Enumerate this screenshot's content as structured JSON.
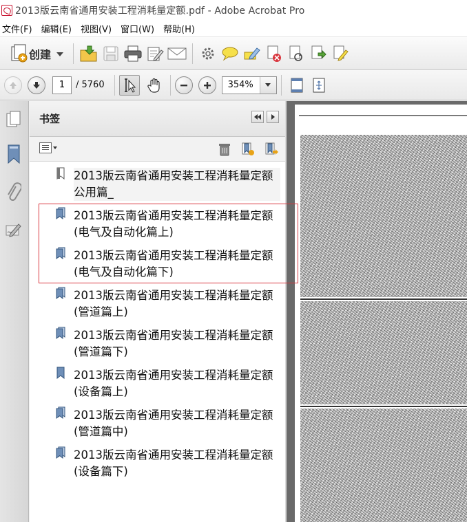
{
  "window": {
    "title": "2013版云南省通用安装工程消耗量定额.pdf - Adobe Acrobat Pro"
  },
  "menu": {
    "items": [
      "文件(F)",
      "编辑(E)",
      "视图(V)",
      "窗口(W)",
      "帮助(H)"
    ]
  },
  "toolbar": {
    "create_label": "创建"
  },
  "navigation": {
    "current_page": "1",
    "total_pages": "/ 5760",
    "zoom": "354%"
  },
  "bookmarks": {
    "panel_title": "书签",
    "items": [
      {
        "label": "2013版云南省通用安装工程消耗量定额公用篇_"
      },
      {
        "label": "2013版云南省通用安装工程消耗量定额(电气及自动化篇上)"
      },
      {
        "label": "2013版云南省通用安装工程消耗量定额(电气及自动化篇下)"
      },
      {
        "label": "2013版云南省通用安装工程消耗量定额(管道篇上)"
      },
      {
        "label": "2013版云南省通用安装工程消耗量定额(管道篇下)"
      },
      {
        "label": "2013版云南省通用安装工程消耗量定额(设备篇上)"
      },
      {
        "label": "2013版云南省通用安装工程消耗量定额(管道篇中)"
      },
      {
        "label": "2013版云南省通用安装工程消耗量定额(设备篇下)"
      }
    ]
  },
  "colors": {
    "highlight_border": "#d9363e",
    "acrobat_red": "#c8102e",
    "bookmark_icon": "#6f8fb8"
  }
}
